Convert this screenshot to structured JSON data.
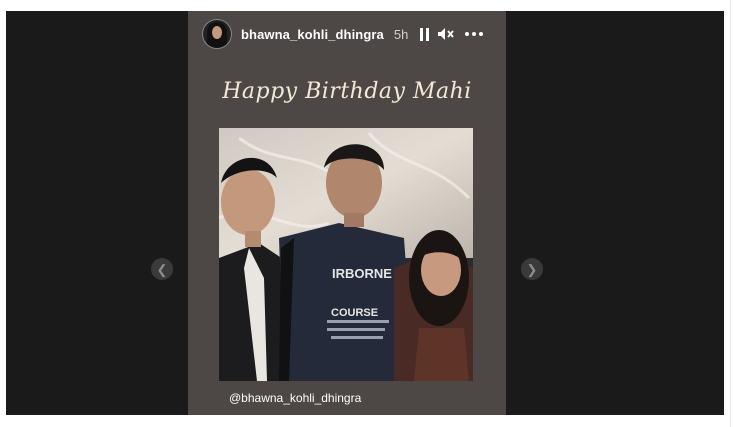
{
  "story": {
    "username": "bhawna_kohli_dhingra",
    "time": "5h",
    "greeting": "Happy Birthday Mahi",
    "photo_tag": "@bhawna_kohli_dhingra",
    "photo_shirt_lines": [
      "IRBORNE",
      "COURSE"
    ]
  },
  "icons": {
    "prev": "chevron-left-icon",
    "next": "chevron-right-icon",
    "pause": "pause-icon",
    "mute": "speaker-muted-icon",
    "more": "more-options-icon"
  },
  "colors": {
    "viewer_bg": "#1a1a1a",
    "story_bg": "#4d4845",
    "greeting_text": "#f2e9d6"
  }
}
